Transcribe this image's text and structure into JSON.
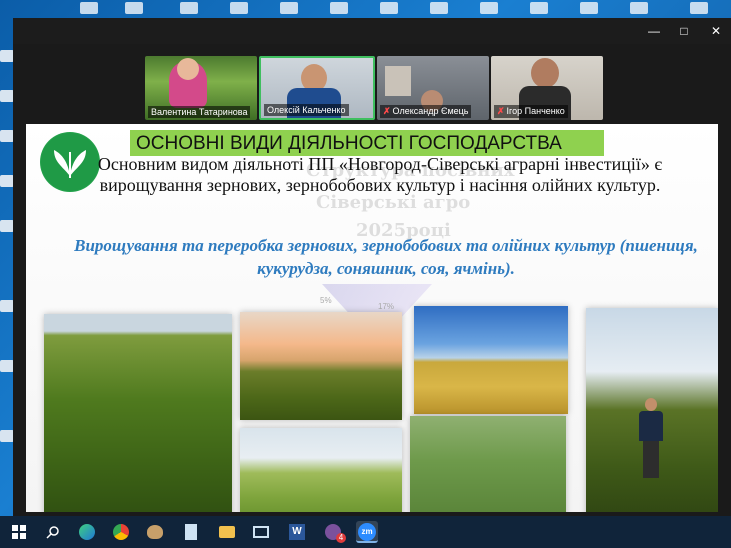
{
  "window": {
    "minimize": "—",
    "maximize": "□",
    "close": "✕"
  },
  "participants": [
    {
      "name": "Валентина Татаринова",
      "muted": false
    },
    {
      "name": "Олексій Кальченко",
      "muted": false
    },
    {
      "name": "Олександр Ємець",
      "muted": true
    },
    {
      "name": "Ігор Панченко",
      "muted": true
    }
  ],
  "slide": {
    "title": "ОСНОВНІ ВИДИ ДІЯЛЬНОСТІ ГОСПОДАРСТВА",
    "paragraph": "Основним видом діяльноті ПП «Новгород-Сіверські аграрні інвестиції» є вирощування зернових, зернобобових культур і насіння олійних культур.",
    "subtitle": "Вирощування та переробка зернових, зернобобових та олійних культур (пшениця, кукурудза, соняшник, соя, ячмінь)."
  },
  "taskbar": {
    "start_icon": "windows-start-icon",
    "search_icon": "search-icon",
    "zoom_label": "zm",
    "badge_count": "4"
  },
  "colors": {
    "title_bg": "#8fd14f",
    "subtitle": "#2e7bbf",
    "active_speaker_border": "#3fbf5f",
    "taskbar": "#10243a"
  }
}
